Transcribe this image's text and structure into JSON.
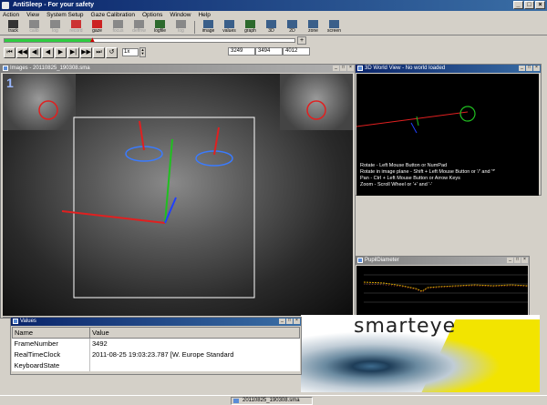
{
  "app": {
    "title": "AntiSleep - For your safety"
  },
  "menu": [
    "Action",
    "View",
    "System Setup",
    "Gaze Calibration",
    "Options",
    "Window",
    "Help"
  ],
  "toolbar": {
    "group1": [
      {
        "label": "track",
        "icon": "eye-icon",
        "color": "#333333",
        "enabled": true
      },
      {
        "label": "calib",
        "icon": "calibrate-icon",
        "color": "#888888",
        "enabled": false
      },
      {
        "label": "log",
        "icon": "disk-icon",
        "color": "#888888",
        "enabled": false
      },
      {
        "label": "record",
        "icon": "record-icon",
        "color": "#cc3333",
        "enabled": false
      },
      {
        "label": "gaze",
        "icon": "gaze-icon",
        "color": "#cc2222",
        "enabled": true
      },
      {
        "label": "focus",
        "icon": "focus-icon",
        "color": "#888888",
        "enabled": false
      },
      {
        "label": "deffnw",
        "icon": "world-icon",
        "color": "#888888",
        "enabled": false
      },
      {
        "label": "logfile",
        "icon": "logfile-icon",
        "color": "#2d6a2d",
        "enabled": true
      },
      {
        "label": "log",
        "icon": "log-icon",
        "color": "#888888",
        "enabled": false
      }
    ],
    "group2": [
      {
        "label": "image",
        "icon": "image-icon",
        "color": "#3a5f8a",
        "enabled": true
      },
      {
        "label": "values",
        "icon": "values-icon",
        "color": "#3a5f8a",
        "enabled": true
      },
      {
        "label": "graph",
        "icon": "graph-icon",
        "color": "#2d6a2d",
        "enabled": true
      },
      {
        "label": "3D",
        "icon": "3d-icon",
        "color": "#3a5f8a",
        "enabled": true
      },
      {
        "label": "2D",
        "icon": "2d-icon",
        "color": "#3a5f8a",
        "enabled": true
      },
      {
        "label": "zone",
        "icon": "zone-icon",
        "color": "#3a5f8a",
        "enabled": true
      },
      {
        "label": "screen",
        "icon": "screen-icon",
        "color": "#3a5f8a",
        "enabled": true
      }
    ]
  },
  "playback": {
    "progress": 0.3,
    "buttons": [
      "⏮",
      "◀◀",
      "◀|",
      "◀",
      "▶",
      "▶|",
      "▶▶",
      "⏭",
      "↺"
    ],
    "speed": "1x",
    "counters": [
      "3249",
      "3494",
      "4012"
    ]
  },
  "images_window": {
    "title": "Images - 20110825_190308.sma",
    "camera_number": "1"
  },
  "world_window": {
    "title": "3D World View - No world loaded",
    "help": [
      "Rotate - Left Mouse Button or NumPad",
      "Rotate in image plane - Shift + Left Mouse Button or '/' and '*'",
      "Pan     - Ctrl + Left Mouse Button or Arrow Keys",
      "Zoom  - Scroll Wheel or '+' and '-'"
    ]
  },
  "pupil_window": {
    "title": "PupilDiameter"
  },
  "values_window": {
    "title": "Values",
    "columns": [
      "Name",
      "Value"
    ],
    "rows": [
      {
        "name": "FrameNumber",
        "value": "3492"
      },
      {
        "name": "RealTimeClock",
        "value": "2011-08-25 19:03:23.787 [W. Europe Standard"
      },
      {
        "name": "KeyboardState",
        "value": ""
      }
    ]
  },
  "banner": {
    "text": "smarteye"
  },
  "status": {
    "file": "20110825_190308.sma"
  },
  "colors": {
    "titlebar": "#0a246a",
    "face_box": "#ffffff",
    "eye_outline": "#3a7bff",
    "axis_red": "#e02020",
    "axis_green": "#20c020",
    "axis_blue": "#2040ff",
    "banner_yellow": "#f2e400"
  }
}
